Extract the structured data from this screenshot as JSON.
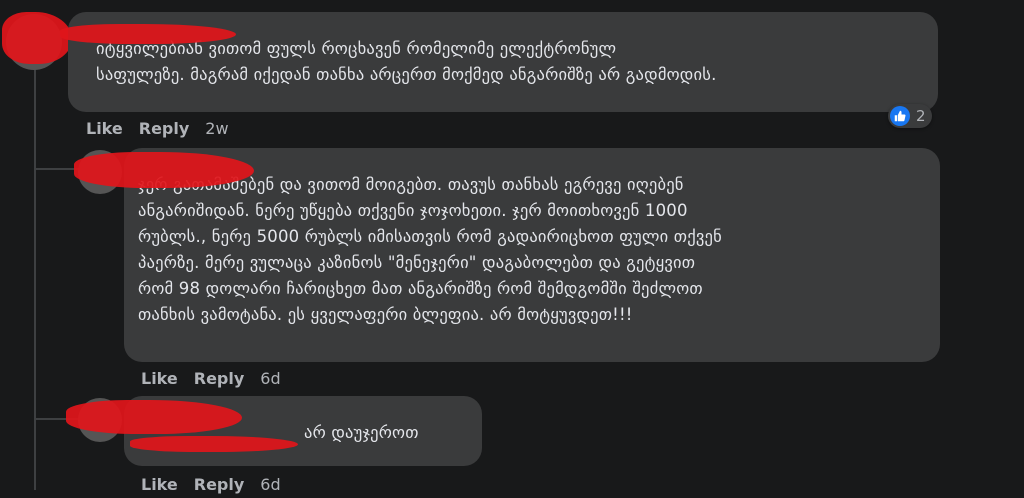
{
  "comments": [
    {
      "text": "იტყვილებიან ვითომ ფულს როცხავენ რომელიმე ელექტრონულ\nსაფულეზე. მაგრამ იქედან თანხა არცერთ მოქმედ ანგარიშზე არ გადმოდის.",
      "like_label": "Like",
      "reply_label": "Reply",
      "time": "2w",
      "reaction_icon": "like-icon",
      "reaction_count": "2"
    },
    {
      "text": "ჯერ გათამაშებენ და ვითომ მოიგებთ. თავუს თანხას ეგრევე იღებენ\nანგარიშიდან. ნერე უწყება თქვენი ჯოჯოხეთი. ჯერ მოითხოვენ 1000\nრუბლს., ნერე 5000 რუბლს იმისათვის რომ გადაირიცხოთ ფული თქვენ\nპაერზე. მერე ვულაცა კაზინოს \"მენეჯერი\" დაგაბოლებთ და გეტყვით\nრომ 98 დოლარი ჩარიცხეთ მათ ანგარიშზე რომ შემდგომში შეძლოთ\nთანხის ვამოტანა. ეს ყველაფერი ბლეფია. არ მოტყუვდეთ!!!",
      "like_label": "Like",
      "reply_label": "Reply",
      "time": "6d"
    },
    {
      "text": "არ დაუჯეროთ",
      "like_label": "Like",
      "reply_label": "Reply",
      "time": "6d"
    }
  ],
  "colors": {
    "background": "#18191a",
    "bubble": "#3a3b3c",
    "text": "#e4e6eb",
    "secondary_text": "#b0b3b8",
    "like_blue": "#1877f2",
    "redaction": "#e0161b"
  }
}
